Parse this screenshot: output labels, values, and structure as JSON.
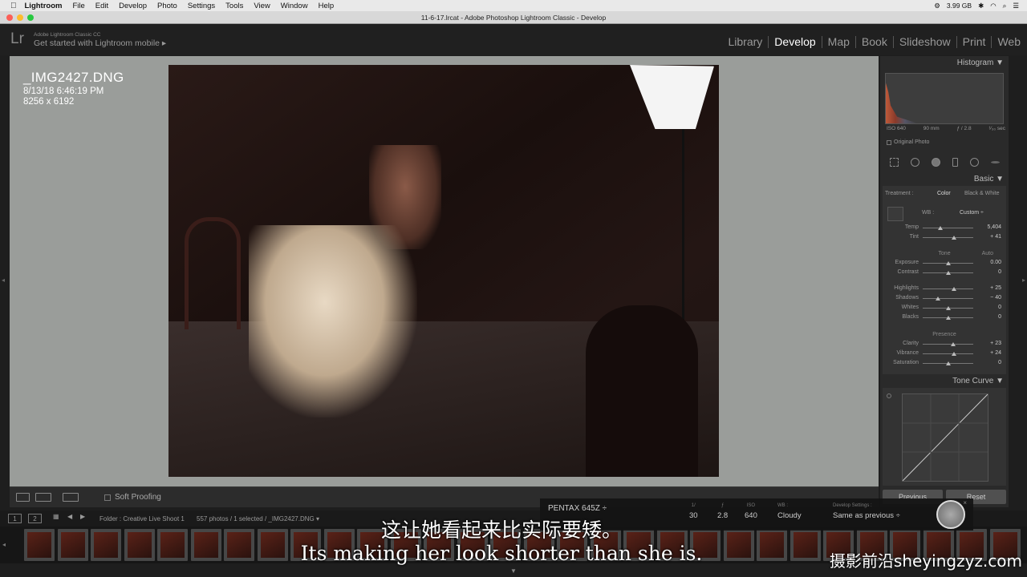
{
  "menubar": {
    "items": [
      "Lightroom",
      "File",
      "Edit",
      "Develop",
      "Photo",
      "Settings",
      "Tools",
      "View",
      "Window",
      "Help"
    ],
    "disk": "3.99 GB"
  },
  "window": {
    "title": "11-6-17.lrcat - Adobe Photoshop Lightroom Classic - Develop"
  },
  "identity": {
    "logo": "Lr",
    "line1": "Adobe Lightroom Classic CC",
    "line2": "Get started with Lightroom mobile  ▸",
    "modules": [
      "Library",
      "Develop",
      "Map",
      "Book",
      "Slideshow",
      "Print",
      "Web"
    ],
    "active_module": "Develop"
  },
  "photo_info": {
    "filename": "_IMG2427.DNG",
    "datetime": "8/13/18 6:46:19 PM",
    "dimensions": "8256 x 6192"
  },
  "toolbar": {
    "soft_proofing": "Soft Proofing"
  },
  "panel": {
    "histogram_title": "Histogram ▼",
    "histo_meta": [
      "ISO 640",
      "90 mm",
      "ƒ / 2.8",
      "¹⁄₃₀ sec"
    ],
    "original_photo": "Original Photo",
    "basic_title": "Basic ▼",
    "treatment_label": "Treatment :",
    "treatment_color": "Color",
    "treatment_bw": "Black & White",
    "wb_label": "WB :",
    "wb_value": "Custom ÷",
    "tone_label": "Tone",
    "auto_label": "Auto",
    "presence_label": "Presence",
    "sliders": [
      {
        "label": "Temp",
        "value": "5,404",
        "pos": 0.35
      },
      {
        "label": "Tint",
        "value": "+ 41",
        "pos": 0.62
      },
      {
        "label": "Exposure",
        "value": "0.00",
        "pos": 0.5
      },
      {
        "label": "Contrast",
        "value": "0",
        "pos": 0.5
      },
      {
        "label": "Highlights",
        "value": "+ 25",
        "pos": 0.62
      },
      {
        "label": "Shadows",
        "value": "− 40",
        "pos": 0.3
      },
      {
        "label": "Whites",
        "value": "0",
        "pos": 0.5
      },
      {
        "label": "Blacks",
        "value": "0",
        "pos": 0.5
      },
      {
        "label": "Clarity",
        "value": "+ 23",
        "pos": 0.61
      },
      {
        "label": "Vibrance",
        "value": "+ 24",
        "pos": 0.62
      },
      {
        "label": "Saturation",
        "value": "0",
        "pos": 0.5
      }
    ],
    "tone_curve_title": "Tone Curve ▼",
    "previous": "Previous",
    "reset": "Reset"
  },
  "filmbar": {
    "page1": "1",
    "page2": "2",
    "folder": "Folder : Creative Live Shoot 1",
    "count": "557 photos / 1 selected / _IMG2427.DNG ▾"
  },
  "camera_hud": {
    "model": "PENTAX 645Z ÷",
    "cols": [
      {
        "h": "1/",
        "v": "30"
      },
      {
        "h": "ƒ",
        "v": "2.8"
      },
      {
        "h": "ISO",
        "v": "640"
      },
      {
        "h": "WB :",
        "v": "Cloudy"
      },
      {
        "h": "Develop Settings :",
        "v": "Same as previous ÷"
      }
    ]
  },
  "subtitle": {
    "cn": "这让她看起来比实际要矮。",
    "en": "Its making her look shorter than she is."
  },
  "watermark": "摄影前沿sheyingzyz.com"
}
